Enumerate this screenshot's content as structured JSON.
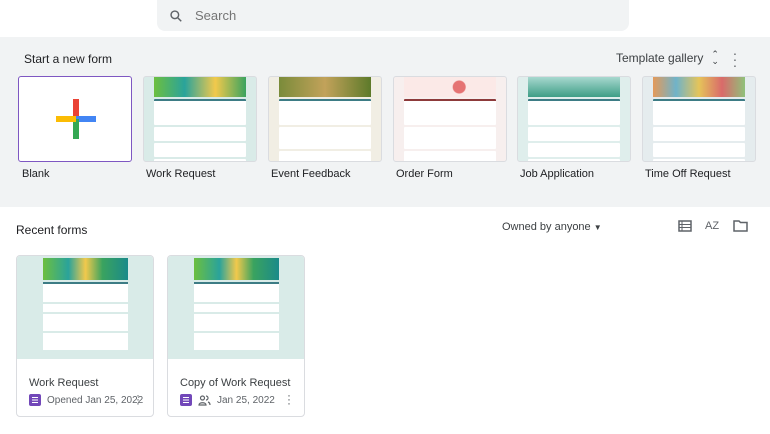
{
  "search": {
    "placeholder": "Search"
  },
  "gallery": {
    "heading": "Start a new form",
    "template_gallery_label": "Template gallery",
    "templates": [
      {
        "label": "Blank"
      },
      {
        "label": "Work Request",
        "header_color": "#6cbf3f",
        "bg": "#d9ebe8"
      },
      {
        "label": "Event Feedback",
        "header_color": "#7a8b3a",
        "bg": "#f1eee4"
      },
      {
        "label": "Order Form",
        "header_color": "#e8a0a0",
        "bg": "#f7efee"
      },
      {
        "label": "Job Application",
        "header_color": "#3e9e86",
        "bg": "#dfeeec"
      },
      {
        "label": "Time Off Request",
        "header_color": "#e49a5a",
        "bg": "#e5ecee"
      }
    ]
  },
  "recent": {
    "heading": "Recent forms",
    "owner_filter": "Owned by anyone",
    "forms": [
      {
        "title": "Work Request",
        "meta": "Opened Jan 25, 2022",
        "shared": false
      },
      {
        "title": "Copy of Work Request",
        "meta": "Jan 25, 2022",
        "shared": true
      }
    ]
  }
}
